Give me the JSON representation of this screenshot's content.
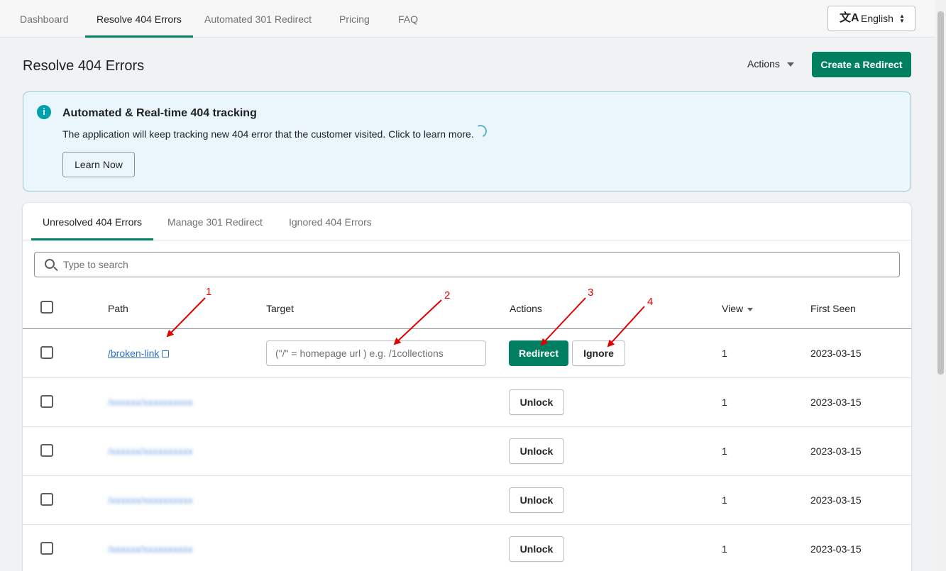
{
  "nav": {
    "tabs": [
      "Dashboard",
      "Resolve 404 Errors",
      "Automated 301 Redirect",
      "Pricing",
      "FAQ"
    ],
    "active_index": 1,
    "language": "English"
  },
  "header": {
    "title": "Resolve 404 Errors",
    "actions_label": "Actions",
    "create_label": "Create a Redirect"
  },
  "banner": {
    "title": "Automated & Real-time 404 tracking",
    "text": "The application will keep tracking new 404 error that the customer visited. Click to learn more.",
    "button_label": "Learn Now"
  },
  "subtabs": [
    "Unresolved 404 Errors",
    "Manage 301 Redirect",
    "Ignored 404 Errors"
  ],
  "search": {
    "placeholder": "Type to search"
  },
  "table": {
    "columns": [
      "Path",
      "Target",
      "Actions",
      "View",
      "First Seen"
    ],
    "target_placeholder": "(\"/\" = homepage url ) e.g. /1collections",
    "redirect_label": "Redirect",
    "ignore_label": "Ignore",
    "unlock_label": "Unlock",
    "rows": [
      {
        "path": "/broken-link",
        "views": "1",
        "first_seen": "2023-03-15"
      },
      {
        "path": "/xxxxxx/xxxxxxxxxx",
        "views": "1",
        "first_seen": "2023-03-15"
      },
      {
        "path": "/xxxxxx/xxxxxxxxxx",
        "views": "1",
        "first_seen": "2023-03-15"
      },
      {
        "path": "/xxxxxx/xxxxxxxxxx",
        "views": "1",
        "first_seen": "2023-03-15"
      },
      {
        "path": "/xxxxxx/xxxxxxxxxx",
        "views": "1",
        "first_seen": "2023-03-15"
      }
    ]
  },
  "annotations": [
    "1",
    "2",
    "3",
    "4"
  ],
  "colors": {
    "primary": "#008060",
    "annotation": "#e00000",
    "banner_bg": "#eaf6fb",
    "link": "#2c6ecb"
  }
}
